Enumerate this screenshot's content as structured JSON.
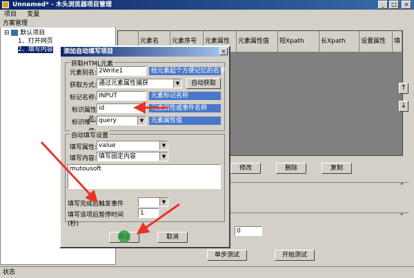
{
  "window": {
    "title": "Unnamed* - 木头浏览器项目管理"
  },
  "menu": {
    "items": [
      "项目",
      "变量"
    ]
  },
  "left_panel": {
    "header": "方案管理",
    "tree": [
      {
        "label": "默认项目"
      },
      {
        "label": "1、打开网页"
      },
      {
        "label": "2、填写内容"
      }
    ]
  },
  "grid": {
    "columns": [
      "元素名",
      "元素序号",
      "元素属性",
      "元素属性值",
      "短Xpath",
      "长Xpath",
      "设置属性",
      "填"
    ]
  },
  "right_buttons": {
    "modify": "修改",
    "delete": "删除",
    "copy": "复制"
  },
  "right_bottom": {
    "number_value": "0",
    "single_step": "单步测试",
    "start_test": "开始测试"
  },
  "dialog": {
    "title": "添加自动填写项目",
    "close": "×",
    "group1": {
      "legend": "获取HTML元素",
      "alias_label": "元素别名:",
      "alias_value": "2Write1",
      "alias_hint": "给元素起个方便记忆的名字",
      "method_label": "获取方式:",
      "method_value": "通过元素属性捕获",
      "auto_button": "自动获取",
      "tag_label": "标记名称:",
      "tag_value": "INPUT",
      "tag_hint": "元素标记名称",
      "attr_label": "标识属性名:",
      "attr_value": "id",
      "attr_hint": "元素属性或事件名称",
      "unique_label": "标识唯一值:",
      "unique_value": "query",
      "unique_hint": "元素属性值"
    },
    "group2": {
      "legend": "自动填写设置",
      "fill_attr_label": "填写属性:",
      "fill_attr_value": "value",
      "fill_content_label": "填写内容:",
      "fill_content_value": "填写固定内容",
      "textarea_value": "mutousoft",
      "event_label": "填写完成后触发事件",
      "pause_label": "填写该项后暂停时间(秒)",
      "pause_value": "1"
    },
    "ok_button": "确定",
    "cancel_button": "取消"
  },
  "status": {
    "text": "状态"
  },
  "colors": {
    "accent_arrow": "#e8322a",
    "hint_bg": "#4a78c8",
    "title_bg": "#0a246a"
  }
}
